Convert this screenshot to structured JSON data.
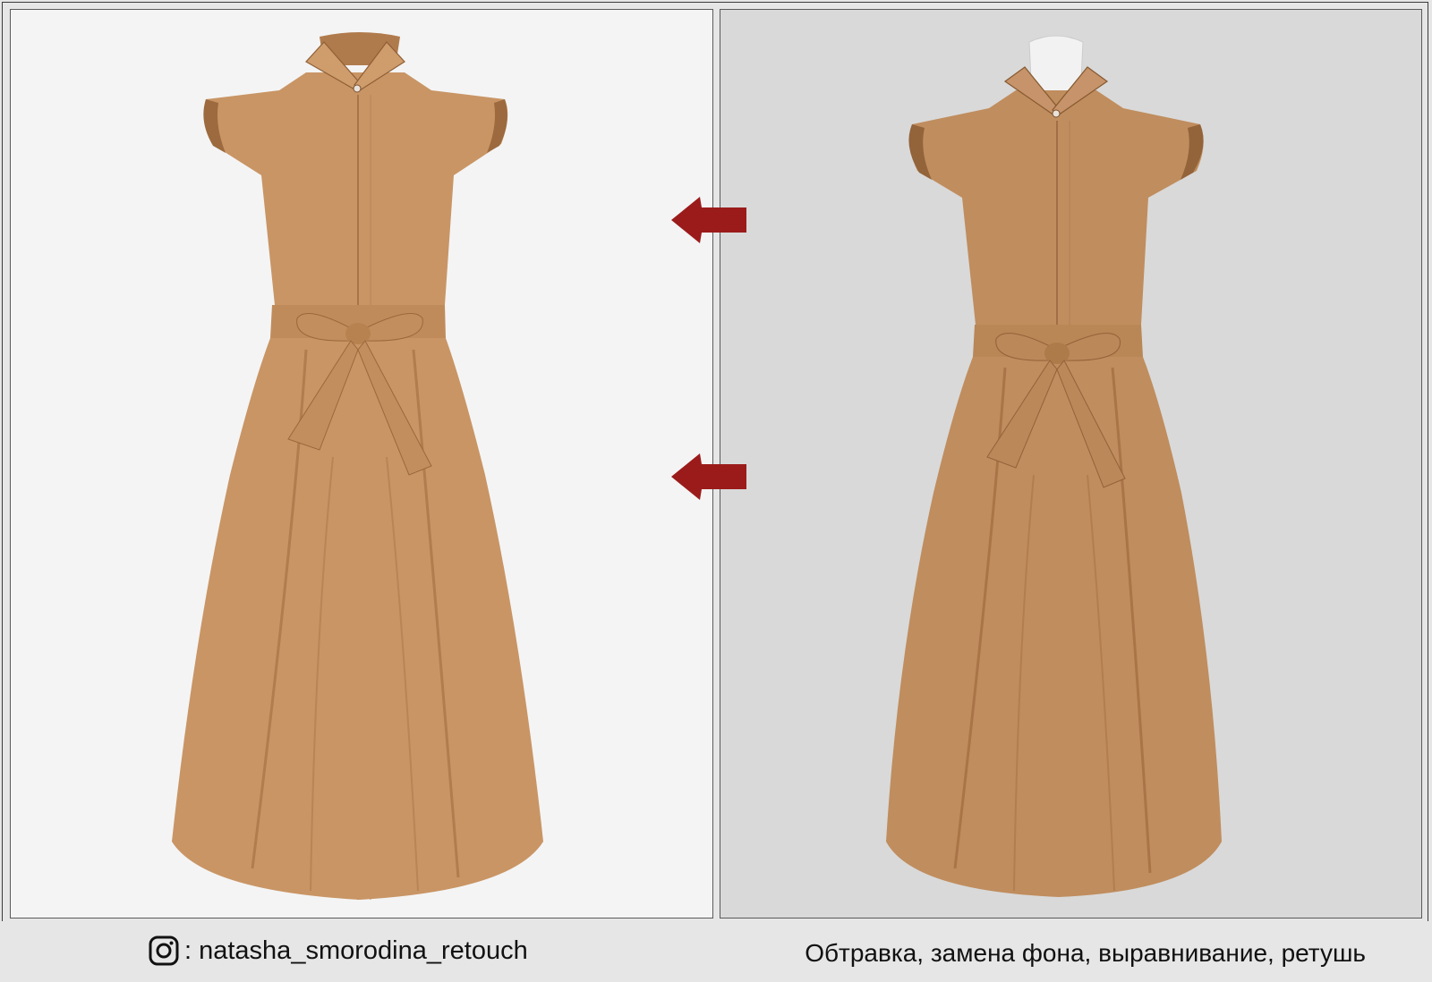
{
  "footer": {
    "instagram_handle": ": natasha_smorodina_retouch",
    "caption": "Обтравка, замена фона, выравнивание, ретушь"
  },
  "colors": {
    "left_background": "#f4f4f4",
    "right_background": "#d9d9d9",
    "dress": "#c99565",
    "dress_shadow": "#a87448",
    "arrow": "#9b1b1b"
  },
  "icons": {
    "instagram": "instagram-icon",
    "arrow": "arrow-left-icon"
  }
}
